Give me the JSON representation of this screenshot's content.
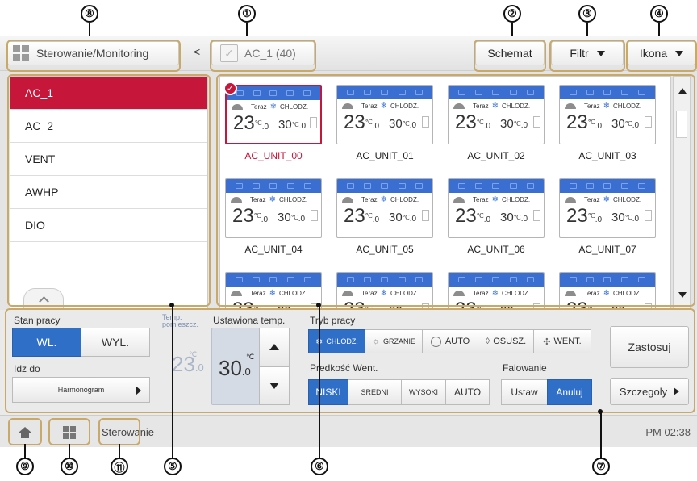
{
  "callouts": [
    "①",
    "②",
    "③",
    "④",
    "⑤",
    "⑥",
    "⑦",
    "⑧",
    "⑨",
    "⑩",
    "⑪"
  ],
  "topbar": {
    "breadcrumb_label": "Sterowanie/Monitoring",
    "back_glyph": "<",
    "group_label": "AC_1 (40)",
    "schemat_label": "Schemat",
    "filtr_label": "Filtr",
    "ikona_label": "Ikona"
  },
  "sidebar": {
    "items": [
      {
        "label": "AC_1",
        "selected": true
      },
      {
        "label": "AC_2"
      },
      {
        "label": "VENT"
      },
      {
        "label": "AWHP"
      },
      {
        "label": "DIO"
      }
    ]
  },
  "unit_card": {
    "now_label": "Teraz",
    "mode_label": "CHLODZ.",
    "current_temp": "23",
    "current_temp_dec": ".0",
    "set_temp": "30",
    "set_temp_dec": ".0",
    "unit": "℃"
  },
  "units": [
    "AC_UNIT_00",
    "AC_UNIT_01",
    "AC_UNIT_02",
    "AC_UNIT_03",
    "AC_UNIT_04",
    "AC_UNIT_05",
    "AC_UNIT_06",
    "AC_UNIT_07",
    "",
    "",
    "",
    ""
  ],
  "control": {
    "stan_label": "Stan pracy",
    "on_label": "WL.",
    "off_label": "WYL.",
    "goto_label": "Idz do",
    "harmonogram_label": "Harmonogram",
    "room_temp_label_1": "Temp.",
    "room_temp_label_2": "pomieszcz.",
    "room_temp": "23",
    "room_temp_dec": ".0",
    "set_temp_label": "Ustawiona temp.",
    "set_temp": "30",
    "set_temp_dec": ".0",
    "unit": "℃",
    "mode_label": "Tryb pracy",
    "modes": [
      "CHLODZ.",
      "GRZANIE",
      "AUTO",
      "OSUSZ.",
      "WENT."
    ],
    "fan_label": "Predkość Went.",
    "fan_speeds": [
      "NISKI",
      "SREDNI",
      "WYSOKI",
      "AUTO"
    ],
    "swing_label": "Falowanie",
    "swing_set": "Ustaw",
    "swing_cancel": "Anuluj",
    "apply_label": "Zastosuj",
    "details_label": "Szczegoly"
  },
  "statusbar": {
    "breadcrumb": "Sterowanie",
    "time": "PM 02:38"
  },
  "colors": {
    "accent": "#c6163a",
    "blue": "#2f6fc8",
    "callout_box": "#c9a96a"
  }
}
